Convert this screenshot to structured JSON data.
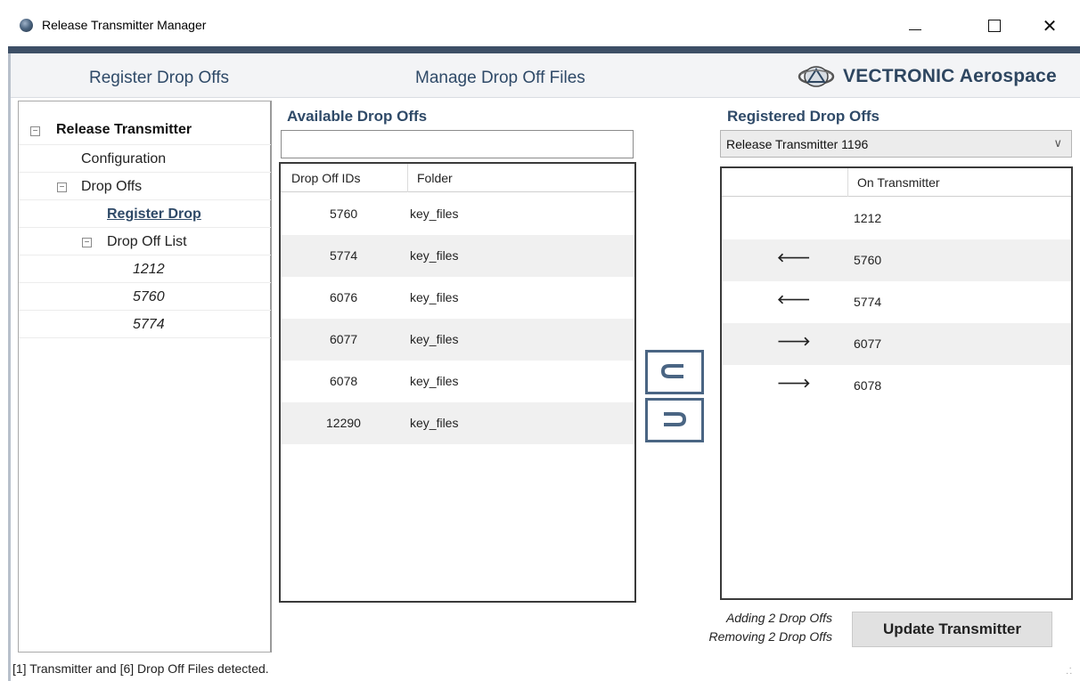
{
  "window": {
    "title": "Release Transmitter Manager",
    "minimize_icon": "minimize-icon",
    "maximize_icon": "maximize-icon",
    "close_icon": "close-icon"
  },
  "header": {
    "tab_register": "Register Drop Offs",
    "tab_manage": "Manage Drop Off Files",
    "brand": "VECTRONIC Aerospace",
    "brand_color": "#2e4660"
  },
  "tree": {
    "root": "Release Transmitter",
    "configuration": "Configuration",
    "drop_offs": "Drop Offs",
    "register_drop": "Register Drop",
    "drop_off_list": "Drop Off List",
    "list_items": [
      "1212",
      "5760",
      "5774"
    ]
  },
  "available": {
    "title": "Available Drop Offs",
    "search_value": "",
    "columns": [
      "Drop Off IDs",
      "Folder"
    ],
    "rows": [
      {
        "id": "5760",
        "folder": "key_files"
      },
      {
        "id": "5774",
        "folder": "key_files"
      },
      {
        "id": "6076",
        "folder": "key_files"
      },
      {
        "id": "6077",
        "folder": "key_files"
      },
      {
        "id": "6078",
        "folder": "key_files"
      },
      {
        "id": "12290",
        "folder": "key_files"
      }
    ]
  },
  "move_buttons": {
    "move_left_icon": "move-left-icon",
    "move_right_icon": "move-right-icon"
  },
  "registered": {
    "title": "Registered Drop Offs",
    "selected_transmitter": "Release Transmitter 1196",
    "columns": [
      "",
      "On Transmitter"
    ],
    "rows": [
      {
        "arrow": "",
        "value": "1212"
      },
      {
        "arrow": "left-red",
        "value": "5760"
      },
      {
        "arrow": "left-red",
        "value": "5774"
      },
      {
        "arrow": "right-green",
        "value": "6077"
      },
      {
        "arrow": "right-green",
        "value": "6078"
      }
    ],
    "colors": {
      "removing": "#9b1c1c",
      "adding": "#1b5c1b"
    }
  },
  "summary": {
    "adding": "Adding 2 Drop Offs",
    "removing": "Removing 2 Drop Offs"
  },
  "update_button": "Update Transmitter",
  "status_text": "[1] Transmitter and [6] Drop Off Files detected."
}
